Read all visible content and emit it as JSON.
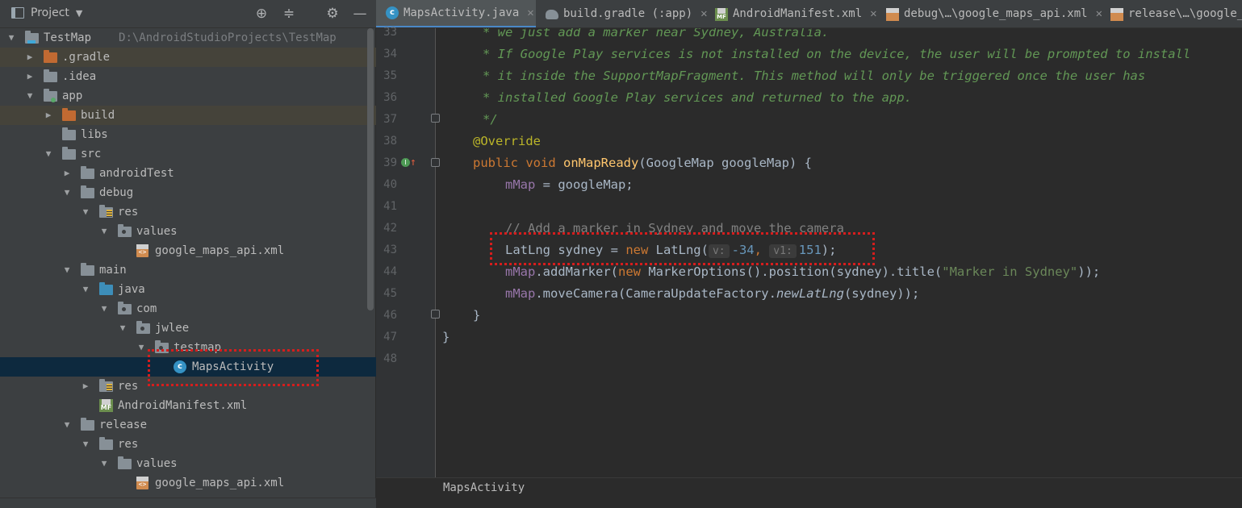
{
  "project_panel": {
    "title": "Project",
    "tools": [
      "crosshair-icon",
      "collapse-icon",
      "gear-icon",
      "hide-icon"
    ],
    "tree": [
      {
        "label": "TestMap",
        "path": "D:\\AndroidStudioProjects\\TestMap",
        "icon": "project-folder-icon",
        "expanded": true
      },
      {
        "label": ".gradle",
        "icon": "folder-orange-icon",
        "expanded": false
      },
      {
        "label": ".idea",
        "icon": "folder-icon",
        "expanded": false
      },
      {
        "label": "app",
        "icon": "module-folder-icon",
        "expanded": true
      },
      {
        "label": "build",
        "icon": "folder-orange-icon",
        "expanded": false
      },
      {
        "label": "libs",
        "icon": "folder-icon"
      },
      {
        "label": "src",
        "icon": "folder-icon",
        "expanded": true
      },
      {
        "label": "androidTest",
        "icon": "folder-icon",
        "expanded": false
      },
      {
        "label": "debug",
        "icon": "folder-icon",
        "expanded": true
      },
      {
        "label": "res",
        "icon": "res-folder-icon",
        "expanded": true
      },
      {
        "label": "values",
        "icon": "package-folder-icon",
        "expanded": true
      },
      {
        "label": "google_maps_api.xml",
        "icon": "xml-file-icon"
      },
      {
        "label": "main",
        "icon": "folder-icon",
        "expanded": true
      },
      {
        "label": "java",
        "icon": "source-folder-icon",
        "expanded": true
      },
      {
        "label": "com",
        "icon": "package-folder-icon",
        "expanded": true
      },
      {
        "label": "jwlee",
        "icon": "package-folder-icon",
        "expanded": true
      },
      {
        "label": "testmap",
        "icon": "package-folder-icon",
        "expanded": true
      },
      {
        "label": "MapsActivity",
        "icon": "class-file-icon"
      },
      {
        "label": "res",
        "icon": "res-folder-icon",
        "expanded": false
      },
      {
        "label": "AndroidManifest.xml",
        "icon": "manifest-file-icon"
      },
      {
        "label": "release",
        "icon": "folder-icon",
        "expanded": true
      },
      {
        "label": "res",
        "icon": "folder-icon",
        "expanded": true
      },
      {
        "label": "values",
        "icon": "folder-icon",
        "expanded": true
      },
      {
        "label": "google_maps_api.xml",
        "icon": "xml-file-icon"
      }
    ]
  },
  "tabs": [
    {
      "label": "MapsActivity.java",
      "icon": "class-file-icon",
      "active": true
    },
    {
      "label": "build.gradle (:app)",
      "icon": "gradle-icon",
      "active": false
    },
    {
      "label": "AndroidManifest.xml",
      "icon": "manifest-file-icon",
      "active": false
    },
    {
      "label": "debug\\…\\google_maps_api.xml",
      "icon": "xml-file-icon",
      "active": false
    },
    {
      "label": "release\\…\\google_m",
      "icon": "xml-file-icon",
      "active": false
    }
  ],
  "tab_close_glyph": "✕",
  "editor": {
    "line_numbers": [
      "33",
      "34",
      "35",
      "36",
      "37",
      "38",
      "39",
      "40",
      "41",
      "42",
      "43",
      "44",
      "45",
      "46",
      "47",
      "48"
    ],
    "code": {
      "l33": "* we just add a marker near Sydney, Australia.",
      "l34": "* If Google Play services is not installed on the device, the user will be prompted to install",
      "l35": "* it inside the SupportMapFragment. This method will only be triggered once the user has",
      "l36": "* installed Google Play services and returned to the app.",
      "l37": "*/",
      "l38": "@Override",
      "l39_kw1": "public",
      "l39_kw2": "void",
      "l39_fn": "onMapReady",
      "l39_rest": "(GoogleMap googleMap) {",
      "l40_field": "mMap",
      "l40_rest": " = googleMap;",
      "l42": "// Add a marker in Sydney and move the camera",
      "l43_a": "LatLng sydney = ",
      "l43_new": "new",
      "l43_b": " LatLng(",
      "l43_hint1": "v:",
      "l43_n1": "-34",
      "l43_comma": ", ",
      "l43_hint2": "v1:",
      "l43_n2": "151",
      "l43_end": ");",
      "l44_field": "mMap",
      "l44_a": ".addMarker(",
      "l44_new": "new",
      "l44_b": " MarkerOptions().position(sydney).title(",
      "l44_str": "\"Marker in Sydney\"",
      "l44_end": "));",
      "l45_field": "mMap",
      "l45_a": ".moveCamera(CameraUpdateFactory.",
      "l45_it": "newLatLng",
      "l45_b": "(sydney));",
      "l46": "}",
      "l47": "}"
    }
  },
  "breadcrumb": "MapsActivity",
  "colors": {
    "annotation": "#d61d1d",
    "selection": "#0d293e",
    "accent_tab": "#4a88c7"
  }
}
